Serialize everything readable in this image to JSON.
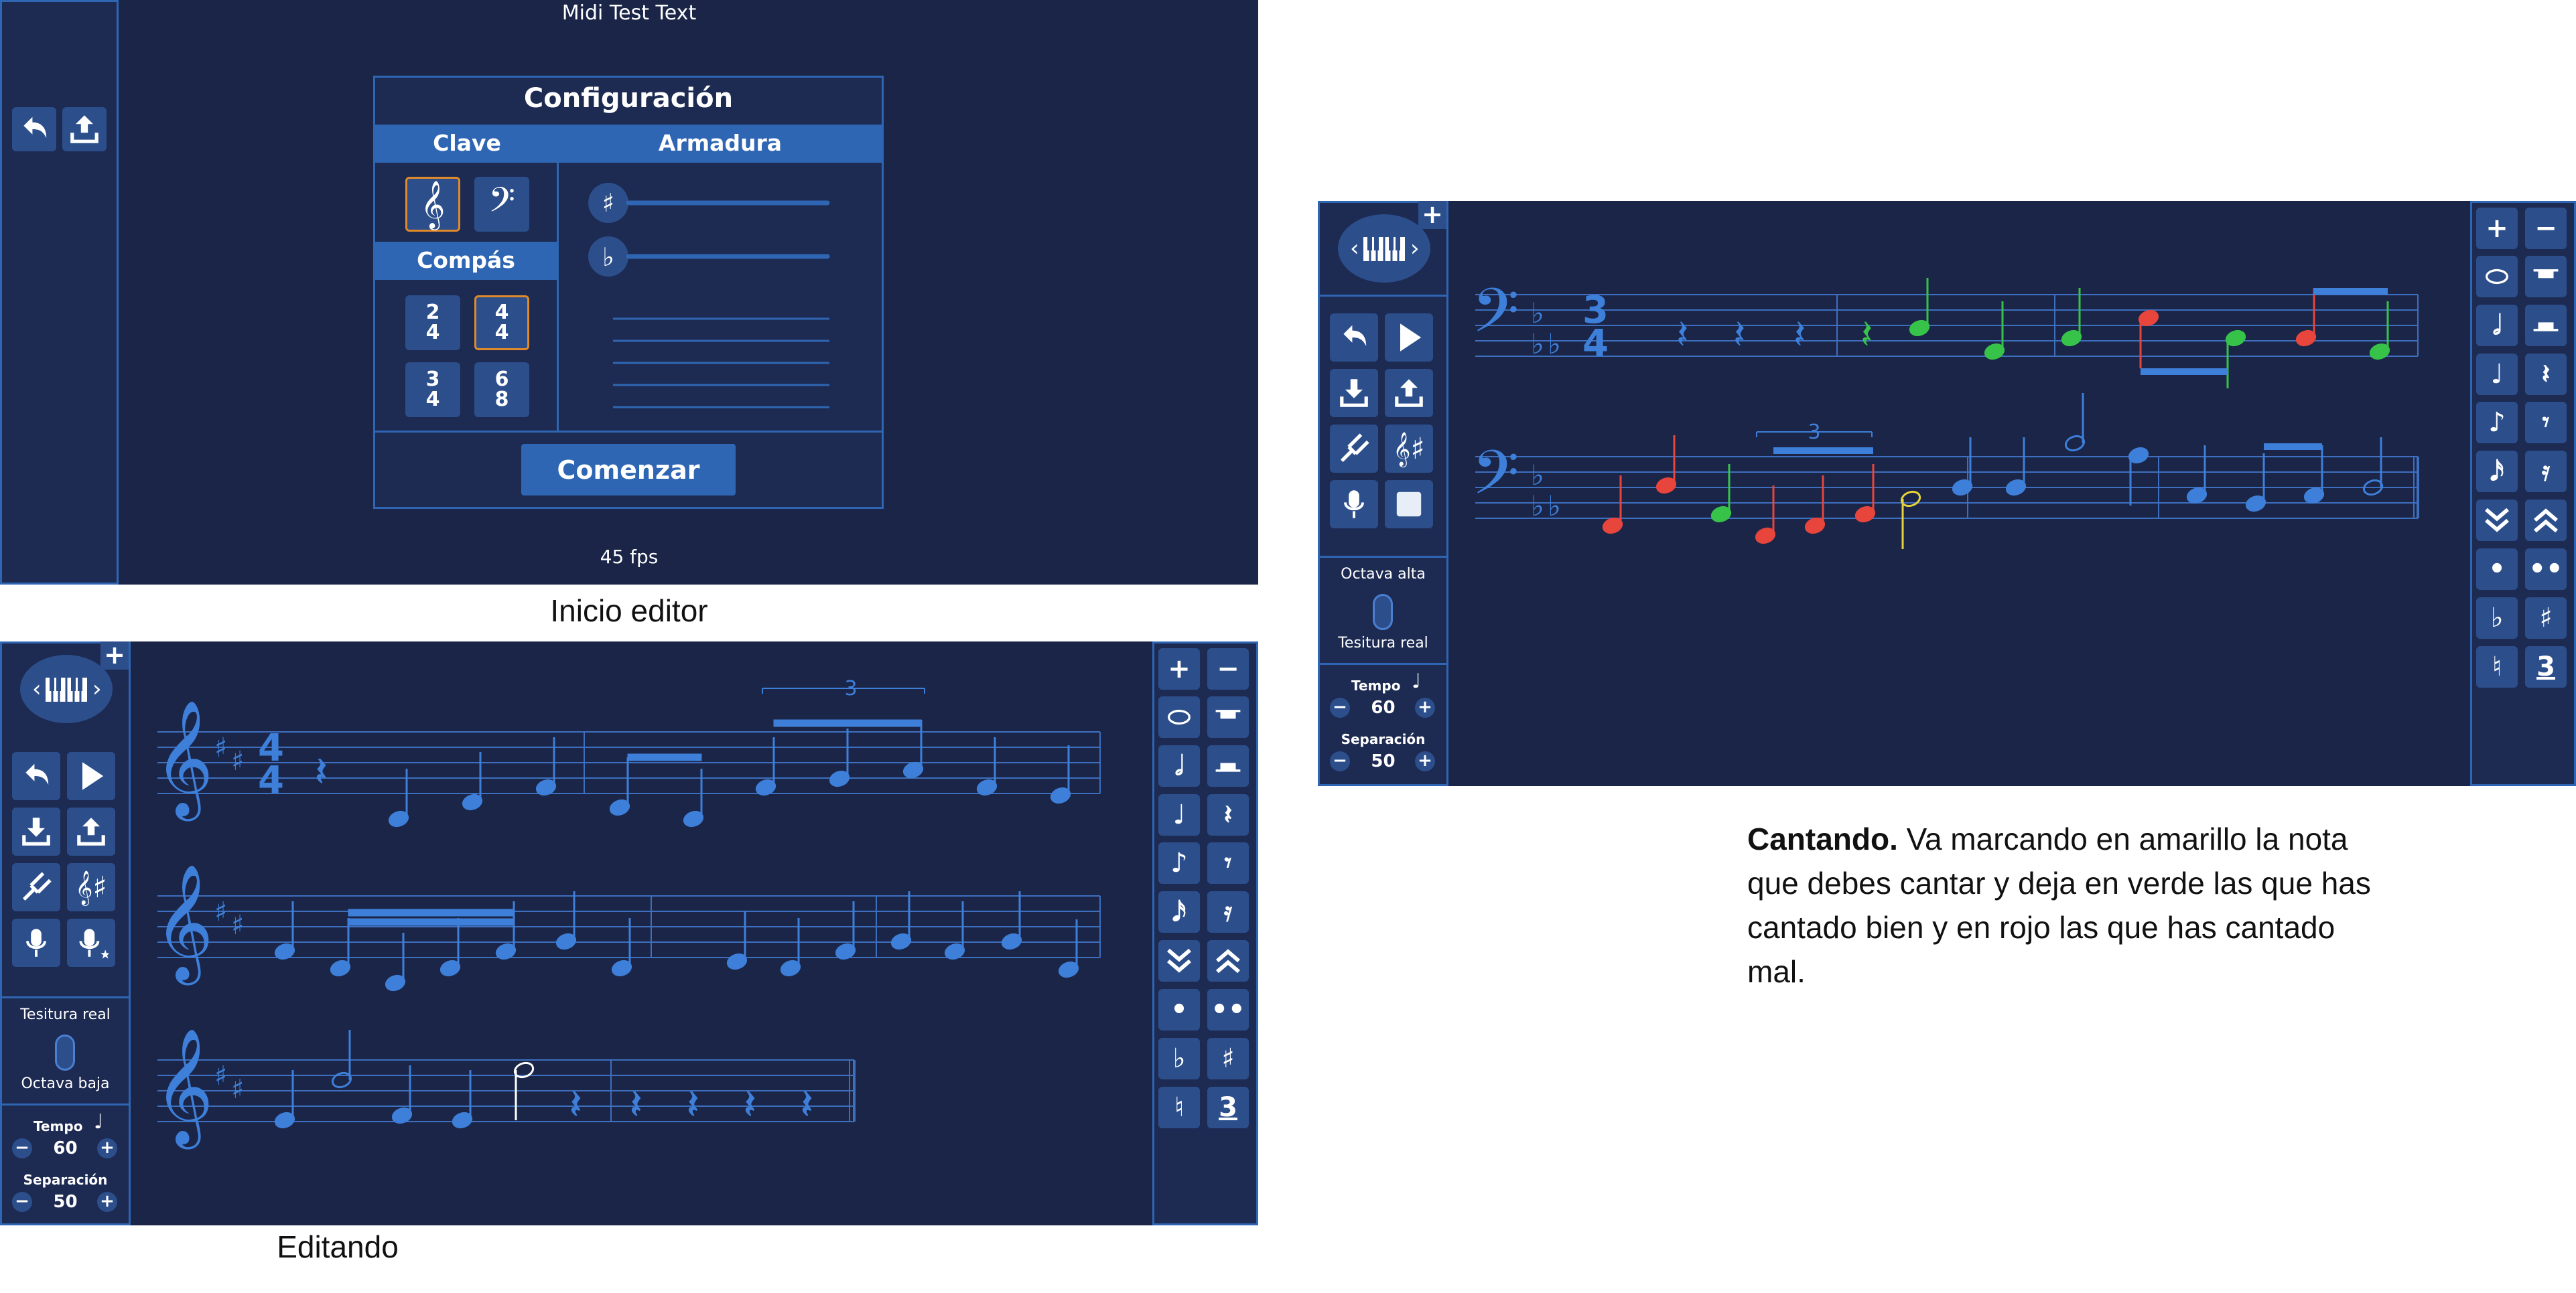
{
  "captions": {
    "inicio": "Inicio editor",
    "editando": "Editando",
    "description_bold": "Cantando.",
    "description_rest": " Va marcando en amarillo la nota que debes cantar y deja en verde las que has cantado bien y en rojo las que has cantado mal."
  },
  "inicio": {
    "window_title": "Midi Test Text",
    "fps": "45 fps",
    "dialog": {
      "title": "Configuración",
      "clave_label": "Clave",
      "armadura_label": "Armadura",
      "compas_label": "Compás",
      "time_signatures": [
        {
          "top": "2",
          "bottom": "4"
        },
        {
          "top": "4",
          "bottom": "4"
        },
        {
          "top": "3",
          "bottom": "4"
        },
        {
          "top": "6",
          "bottom": "8"
        }
      ],
      "start_button": "Comenzar"
    }
  },
  "editando": {
    "tuplet_label": "3",
    "time_sig_top": "4",
    "time_sig_bottom": "4",
    "toggle_top_label": "Tesitura real",
    "toggle_bottom_label": "Octava baja",
    "tempo_label": "Tempo",
    "tempo_value": "60",
    "separation_label": "Separación",
    "separation_value": "50",
    "triplet_button": "3"
  },
  "cantando": {
    "tuplet_label": "3",
    "time_sig_top": "3",
    "time_sig_bottom": "4",
    "toggle_top_label": "Octava alta",
    "toggle_bottom_label": "Tesitura real",
    "tempo_label": "Tempo",
    "tempo_value": "60",
    "separation_label": "Separación",
    "separation_value": "50",
    "triplet_button": "3",
    "colors": {
      "correct": "#37c24a",
      "wrong": "#e8453c",
      "current": "#e6d23a",
      "default": "#3e7fd9"
    }
  },
  "icons": {
    "left_panel": [
      "undo-icon",
      "upload-icon"
    ],
    "editor_controls": [
      "piano-icon",
      "undo-icon",
      "play-icon",
      "download-icon",
      "upload-icon",
      "tuning-fork-icon",
      "key-signature-icon",
      "microphone-icon",
      "microphone-star-icon"
    ],
    "singing_controls": [
      "piano-icon",
      "undo-icon",
      "play-icon",
      "download-icon",
      "upload-icon",
      "tuning-fork-icon",
      "key-signature-icon",
      "microphone-icon",
      "stop-icon"
    ]
  }
}
